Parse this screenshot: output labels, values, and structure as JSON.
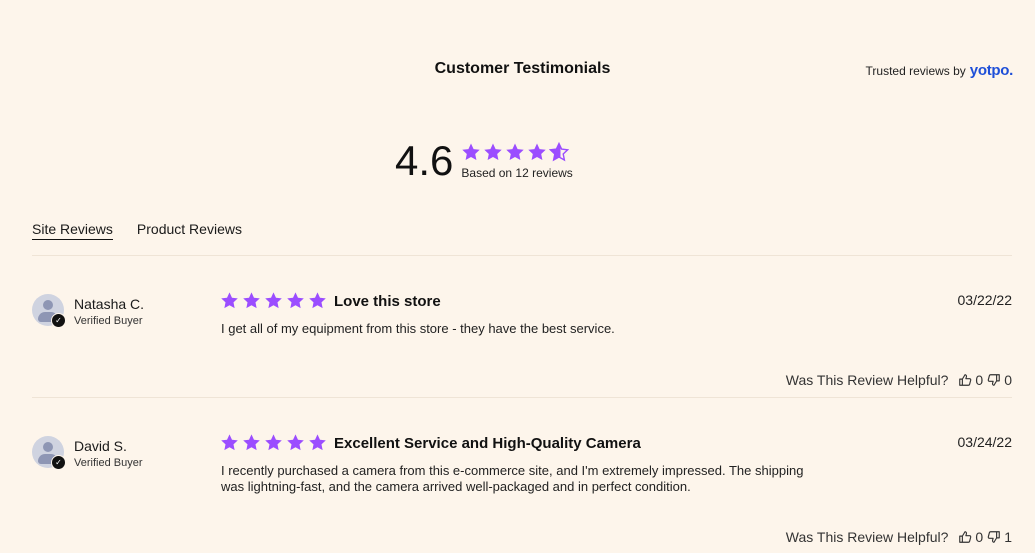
{
  "header": {
    "title": "Customer Testimonials",
    "trusted_text": "Trusted reviews by",
    "brand": "yotpo."
  },
  "summary": {
    "score": "4.6",
    "rating": 4.6,
    "stars_max": 5,
    "based_on": "Based on 12 reviews"
  },
  "colors": {
    "star": "#9b4dff",
    "brand": "#1e4fd8",
    "background": "#fdf5eb"
  },
  "tabs": [
    {
      "label": "Site Reviews",
      "active": true
    },
    {
      "label": "Product Reviews",
      "active": false
    }
  ],
  "reviews": [
    {
      "name": "Natasha C.",
      "status": "Verified Buyer",
      "rating": 5,
      "title": "Love this store",
      "date": "03/22/22",
      "body": "I get all of my equipment from this store - they have the best service.",
      "helpful_question": "Was This Review Helpful?",
      "up": "0",
      "down": "0"
    },
    {
      "name": "David S.",
      "status": "Verified Buyer",
      "rating": 5,
      "title": "Excellent Service and High-Quality Camera",
      "date": "03/24/22",
      "body": "I recently purchased a camera from this e-commerce site, and I'm extremely impressed. The shipping was lightning-fast, and the camera arrived well-packaged and in perfect condition.",
      "helpful_question": "Was This Review Helpful?",
      "up": "0",
      "down": "1"
    }
  ]
}
